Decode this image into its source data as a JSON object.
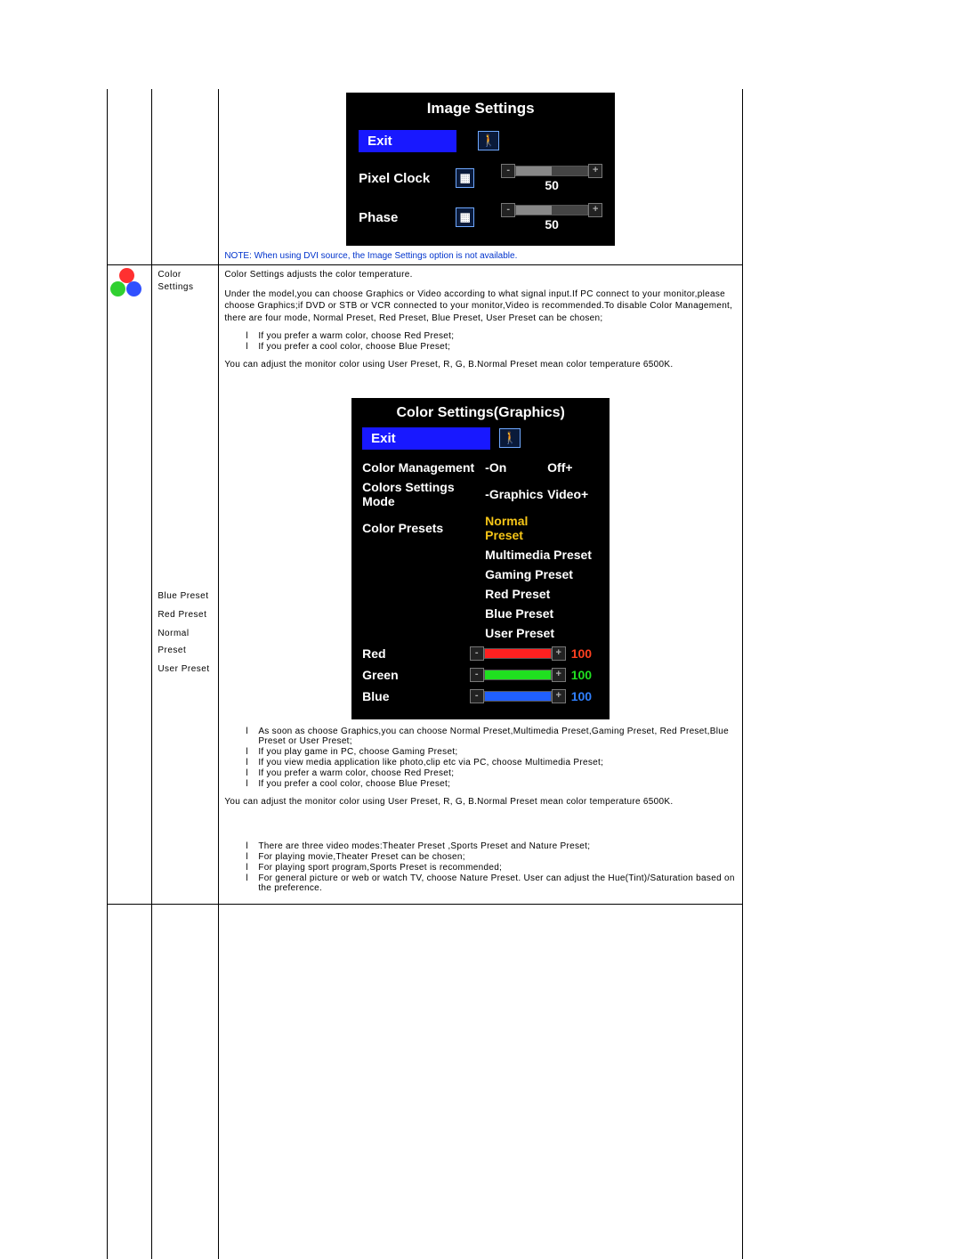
{
  "row1": {
    "osd": {
      "title": "Image Settings",
      "exit": "Exit",
      "items": [
        {
          "label": "Pixel Clock",
          "value": "50"
        },
        {
          "label": "Phase",
          "value": "50"
        }
      ]
    },
    "note": "NOTE: When using  DVI source, the Image Settings option is not available."
  },
  "row2": {
    "name": "Color Settings",
    "sub_presets": [
      "Blue Preset",
      "Red Preset",
      "Normal Preset",
      "User Preset"
    ],
    "intro1": "Color Settings adjusts the color temperature.",
    "intro2": "Under the model,you can choose Graphics or Video according to what signal input.If PC connect to your monitor,please choose Graphics;if DVD or STB or VCR connected to your monitor,Video is recommended.To disable Color Management, there are four mode, Normal Preset, Red Preset, Blue Preset, User Preset can be chosen;",
    "l1": [
      "If you prefer a warm color, choose Red Preset;",
      "If you prefer a cool color, choose Blue Preset;"
    ],
    "para2": "You can adjust the monitor color using User Preset, R, G, B.Normal Preset mean color temperature 6500K.",
    "osd2": {
      "title": "Color Settings(Graphics)",
      "exit": "Exit",
      "mgmt": {
        "label": "Color Management",
        "on": "-On",
        "off": "Off+"
      },
      "mode": {
        "label": "Colors Settings Mode",
        "g": "-Graphics",
        "v": "Video+"
      },
      "presets_label": "Color Presets",
      "presets": [
        {
          "text": "Normal Preset",
          "hl": true
        },
        {
          "text": "Multimedia Preset"
        },
        {
          "text": "Gaming Preset"
        },
        {
          "text": "Red Preset"
        },
        {
          "text": "Blue Preset"
        },
        {
          "text": "User Preset"
        }
      ],
      "rgb": [
        {
          "label": "Red",
          "value": "100",
          "cls": "red"
        },
        {
          "label": "Green",
          "value": "100",
          "cls": "green"
        },
        {
          "label": "Blue",
          "value": "100",
          "cls": "blue"
        }
      ]
    },
    "l2": [
      "As soon as choose Graphics,you can choose Normal Preset,Multimedia Preset,Gaming Preset, Red Preset,Blue Preset or User Preset;",
      "If you play game in PC, choose Gaming Preset;",
      "If you view media application like photo,clip etc via PC, choose Multimedia Preset;",
      "If you prefer a warm color, choose Red Preset;",
      "If you prefer a cool color, choose Blue Preset;"
    ],
    "para3": "You can adjust the monitor color using User Preset, R, G, B.Normal Preset mean color temperature 6500K.",
    "l3": [
      "There are three video modes:Theater Preset ,Sports Preset and Nature Preset;",
      "For playing movie,Theater Preset can be chosen;",
      "For playing sport program,Sports Preset is recommended;",
      "For general picture or web or watch TV, choose Nature Preset. User can adjust the Hue(Tint)/Saturation based on the preference."
    ]
  }
}
